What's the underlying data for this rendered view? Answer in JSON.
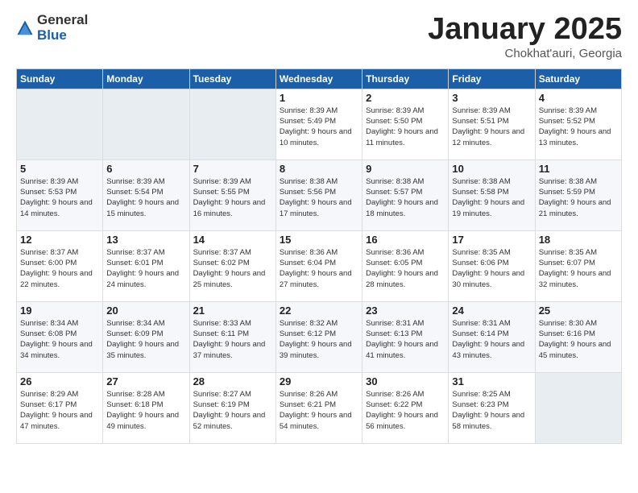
{
  "logo": {
    "general": "General",
    "blue": "Blue"
  },
  "header": {
    "month": "January 2025",
    "location": "Chokhat'auri, Georgia"
  },
  "weekdays": [
    "Sunday",
    "Monday",
    "Tuesday",
    "Wednesday",
    "Thursday",
    "Friday",
    "Saturday"
  ],
  "weeks": [
    [
      {
        "day": "",
        "sunrise": "",
        "sunset": "",
        "daylight": ""
      },
      {
        "day": "",
        "sunrise": "",
        "sunset": "",
        "daylight": ""
      },
      {
        "day": "",
        "sunrise": "",
        "sunset": "",
        "daylight": ""
      },
      {
        "day": "1",
        "sunrise": "Sunrise: 8:39 AM",
        "sunset": "Sunset: 5:49 PM",
        "daylight": "Daylight: 9 hours and 10 minutes."
      },
      {
        "day": "2",
        "sunrise": "Sunrise: 8:39 AM",
        "sunset": "Sunset: 5:50 PM",
        "daylight": "Daylight: 9 hours and 11 minutes."
      },
      {
        "day": "3",
        "sunrise": "Sunrise: 8:39 AM",
        "sunset": "Sunset: 5:51 PM",
        "daylight": "Daylight: 9 hours and 12 minutes."
      },
      {
        "day": "4",
        "sunrise": "Sunrise: 8:39 AM",
        "sunset": "Sunset: 5:52 PM",
        "daylight": "Daylight: 9 hours and 13 minutes."
      }
    ],
    [
      {
        "day": "5",
        "sunrise": "Sunrise: 8:39 AM",
        "sunset": "Sunset: 5:53 PM",
        "daylight": "Daylight: 9 hours and 14 minutes."
      },
      {
        "day": "6",
        "sunrise": "Sunrise: 8:39 AM",
        "sunset": "Sunset: 5:54 PM",
        "daylight": "Daylight: 9 hours and 15 minutes."
      },
      {
        "day": "7",
        "sunrise": "Sunrise: 8:39 AM",
        "sunset": "Sunset: 5:55 PM",
        "daylight": "Daylight: 9 hours and 16 minutes."
      },
      {
        "day": "8",
        "sunrise": "Sunrise: 8:38 AM",
        "sunset": "Sunset: 5:56 PM",
        "daylight": "Daylight: 9 hours and 17 minutes."
      },
      {
        "day": "9",
        "sunrise": "Sunrise: 8:38 AM",
        "sunset": "Sunset: 5:57 PM",
        "daylight": "Daylight: 9 hours and 18 minutes."
      },
      {
        "day": "10",
        "sunrise": "Sunrise: 8:38 AM",
        "sunset": "Sunset: 5:58 PM",
        "daylight": "Daylight: 9 hours and 19 minutes."
      },
      {
        "day": "11",
        "sunrise": "Sunrise: 8:38 AM",
        "sunset": "Sunset: 5:59 PM",
        "daylight": "Daylight: 9 hours and 21 minutes."
      }
    ],
    [
      {
        "day": "12",
        "sunrise": "Sunrise: 8:37 AM",
        "sunset": "Sunset: 6:00 PM",
        "daylight": "Daylight: 9 hours and 22 minutes."
      },
      {
        "day": "13",
        "sunrise": "Sunrise: 8:37 AM",
        "sunset": "Sunset: 6:01 PM",
        "daylight": "Daylight: 9 hours and 24 minutes."
      },
      {
        "day": "14",
        "sunrise": "Sunrise: 8:37 AM",
        "sunset": "Sunset: 6:02 PM",
        "daylight": "Daylight: 9 hours and 25 minutes."
      },
      {
        "day": "15",
        "sunrise": "Sunrise: 8:36 AM",
        "sunset": "Sunset: 6:04 PM",
        "daylight": "Daylight: 9 hours and 27 minutes."
      },
      {
        "day": "16",
        "sunrise": "Sunrise: 8:36 AM",
        "sunset": "Sunset: 6:05 PM",
        "daylight": "Daylight: 9 hours and 28 minutes."
      },
      {
        "day": "17",
        "sunrise": "Sunrise: 8:35 AM",
        "sunset": "Sunset: 6:06 PM",
        "daylight": "Daylight: 9 hours and 30 minutes."
      },
      {
        "day": "18",
        "sunrise": "Sunrise: 8:35 AM",
        "sunset": "Sunset: 6:07 PM",
        "daylight": "Daylight: 9 hours and 32 minutes."
      }
    ],
    [
      {
        "day": "19",
        "sunrise": "Sunrise: 8:34 AM",
        "sunset": "Sunset: 6:08 PM",
        "daylight": "Daylight: 9 hours and 34 minutes."
      },
      {
        "day": "20",
        "sunrise": "Sunrise: 8:34 AM",
        "sunset": "Sunset: 6:09 PM",
        "daylight": "Daylight: 9 hours and 35 minutes."
      },
      {
        "day": "21",
        "sunrise": "Sunrise: 8:33 AM",
        "sunset": "Sunset: 6:11 PM",
        "daylight": "Daylight: 9 hours and 37 minutes."
      },
      {
        "day": "22",
        "sunrise": "Sunrise: 8:32 AM",
        "sunset": "Sunset: 6:12 PM",
        "daylight": "Daylight: 9 hours and 39 minutes."
      },
      {
        "day": "23",
        "sunrise": "Sunrise: 8:31 AM",
        "sunset": "Sunset: 6:13 PM",
        "daylight": "Daylight: 9 hours and 41 minutes."
      },
      {
        "day": "24",
        "sunrise": "Sunrise: 8:31 AM",
        "sunset": "Sunset: 6:14 PM",
        "daylight": "Daylight: 9 hours and 43 minutes."
      },
      {
        "day": "25",
        "sunrise": "Sunrise: 8:30 AM",
        "sunset": "Sunset: 6:16 PM",
        "daylight": "Daylight: 9 hours and 45 minutes."
      }
    ],
    [
      {
        "day": "26",
        "sunrise": "Sunrise: 8:29 AM",
        "sunset": "Sunset: 6:17 PM",
        "daylight": "Daylight: 9 hours and 47 minutes."
      },
      {
        "day": "27",
        "sunrise": "Sunrise: 8:28 AM",
        "sunset": "Sunset: 6:18 PM",
        "daylight": "Daylight: 9 hours and 49 minutes."
      },
      {
        "day": "28",
        "sunrise": "Sunrise: 8:27 AM",
        "sunset": "Sunset: 6:19 PM",
        "daylight": "Daylight: 9 hours and 52 minutes."
      },
      {
        "day": "29",
        "sunrise": "Sunrise: 8:26 AM",
        "sunset": "Sunset: 6:21 PM",
        "daylight": "Daylight: 9 hours and 54 minutes."
      },
      {
        "day": "30",
        "sunrise": "Sunrise: 8:26 AM",
        "sunset": "Sunset: 6:22 PM",
        "daylight": "Daylight: 9 hours and 56 minutes."
      },
      {
        "day": "31",
        "sunrise": "Sunrise: 8:25 AM",
        "sunset": "Sunset: 6:23 PM",
        "daylight": "Daylight: 9 hours and 58 minutes."
      },
      {
        "day": "",
        "sunrise": "",
        "sunset": "",
        "daylight": ""
      }
    ]
  ]
}
